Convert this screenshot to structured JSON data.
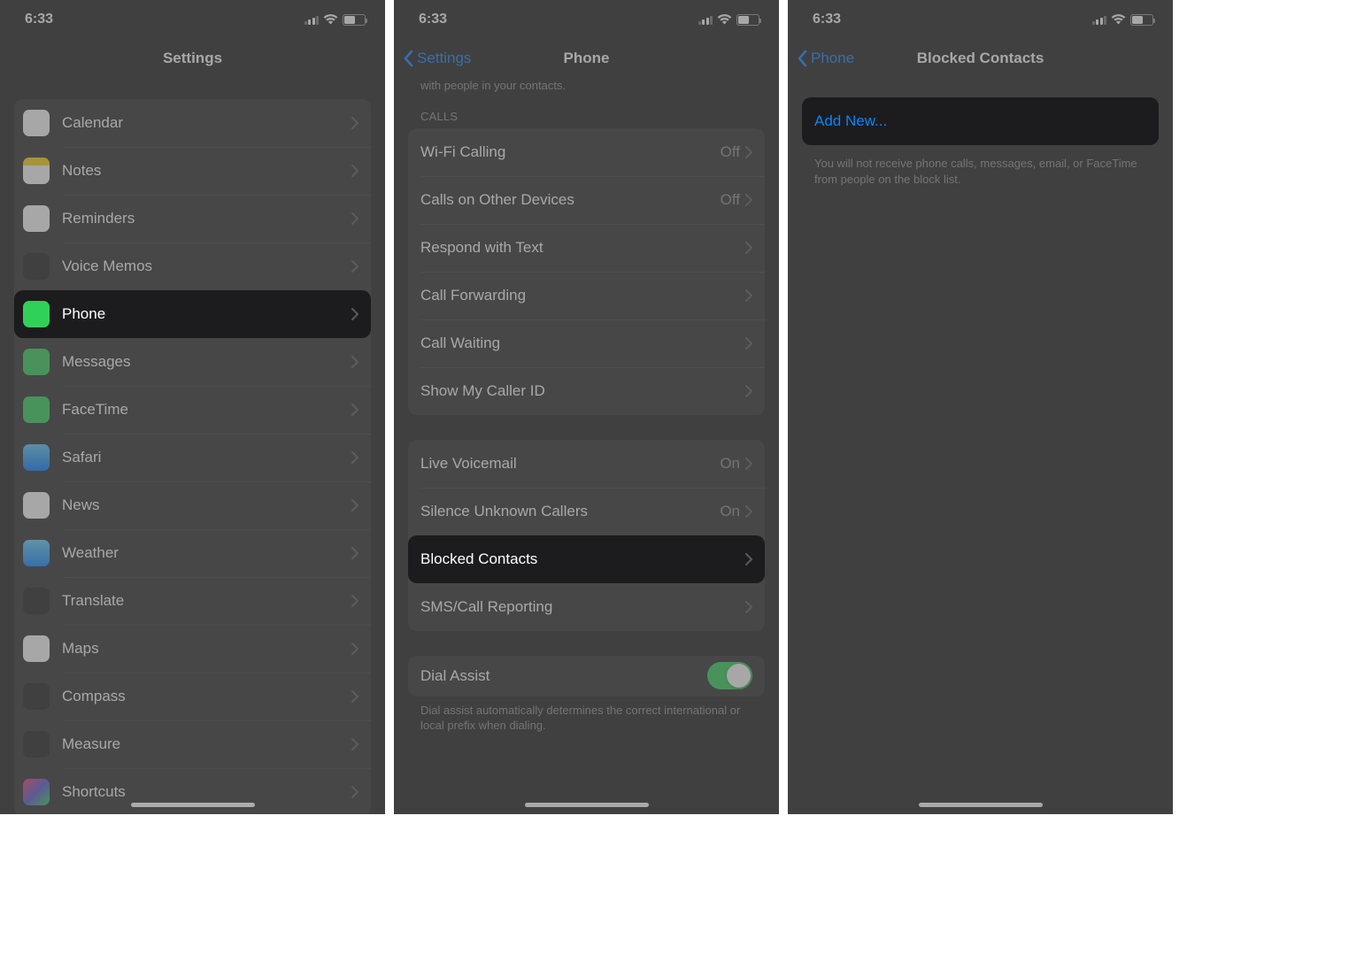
{
  "status": {
    "time": "6:33",
    "battery": "48"
  },
  "screen1": {
    "title": "Settings",
    "items": [
      {
        "label": "Calendar",
        "icon": "calendar"
      },
      {
        "label": "Notes",
        "icon": "notes"
      },
      {
        "label": "Reminders",
        "icon": "reminders"
      },
      {
        "label": "Voice Memos",
        "icon": "voicememos"
      },
      {
        "label": "Phone",
        "icon": "phone",
        "highlight": true
      },
      {
        "label": "Messages",
        "icon": "messages"
      },
      {
        "label": "FaceTime",
        "icon": "facetime"
      },
      {
        "label": "Safari",
        "icon": "safari"
      },
      {
        "label": "News",
        "icon": "news"
      },
      {
        "label": "Weather",
        "icon": "weather"
      },
      {
        "label": "Translate",
        "icon": "translate"
      },
      {
        "label": "Maps",
        "icon": "maps"
      },
      {
        "label": "Compass",
        "icon": "compass"
      },
      {
        "label": "Measure",
        "icon": "measure"
      },
      {
        "label": "Shortcuts",
        "icon": "shortcuts"
      }
    ]
  },
  "screen2": {
    "back": "Settings",
    "title": "Phone",
    "top_text": "with people in your contacts.",
    "calls_header": "CALLS",
    "calls": [
      {
        "label": "Wi-Fi Calling",
        "value": "Off"
      },
      {
        "label": "Calls on Other Devices",
        "value": "Off"
      },
      {
        "label": "Respond with Text"
      },
      {
        "label": "Call Forwarding"
      },
      {
        "label": "Call Waiting"
      },
      {
        "label": "Show My Caller ID"
      }
    ],
    "group2": [
      {
        "label": "Live Voicemail",
        "value": "On"
      },
      {
        "label": "Silence Unknown Callers",
        "value": "On"
      },
      {
        "label": "Blocked Contacts",
        "highlight": true
      },
      {
        "label": "SMS/Call Reporting"
      }
    ],
    "dial_assist": "Dial Assist",
    "dial_footer": "Dial assist automatically determines the correct international or local prefix when dialing."
  },
  "screen3": {
    "back": "Phone",
    "title": "Blocked Contacts",
    "add_new": "Add New...",
    "footer": "You will not receive phone calls, messages, email, or FaceTime from people on the block list."
  }
}
